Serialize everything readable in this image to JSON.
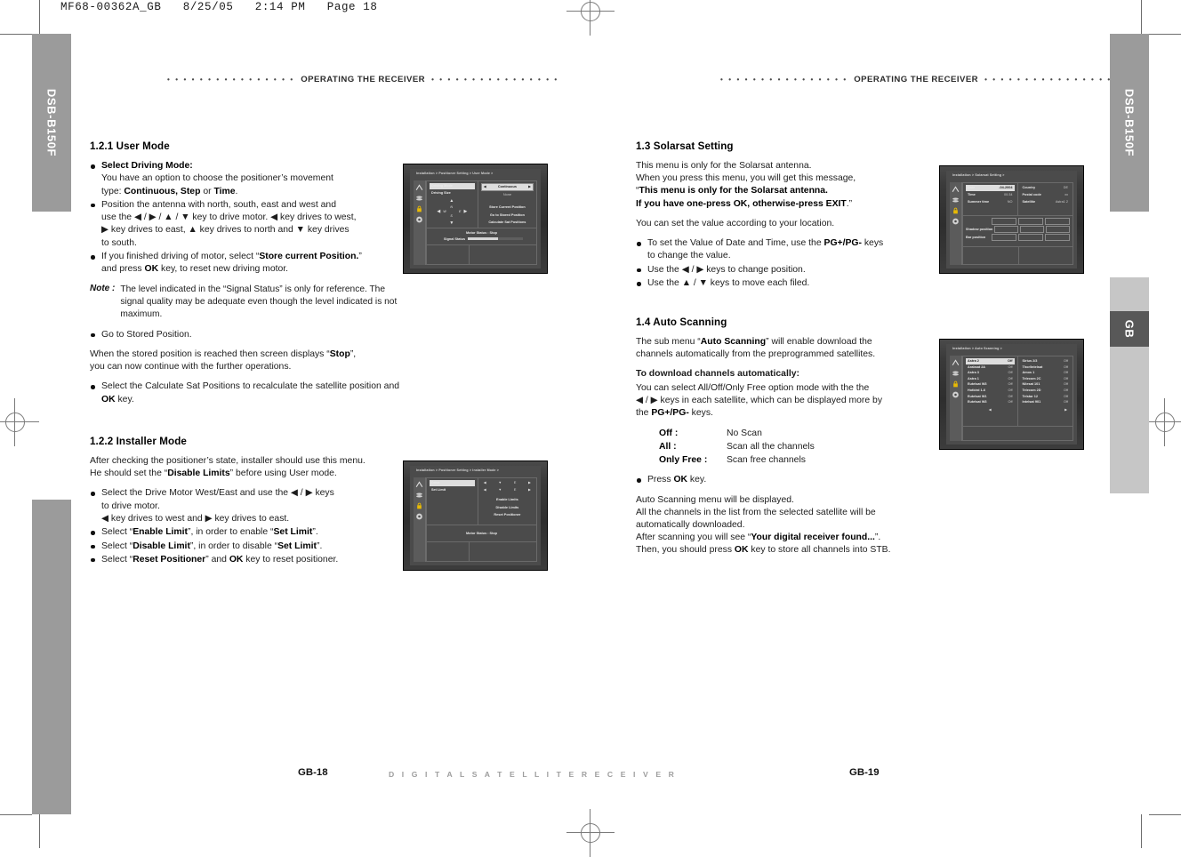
{
  "proof_header": "MF68-00362A_GB   8/25/05   2:14 PM   Page 18",
  "side_tabs": {
    "left_model": "DSB-B150F",
    "right_model": "DSB-B150F",
    "lang_tab": "GB"
  },
  "running_head": {
    "left": "OPERATING THE RECEIVER",
    "right": "OPERATING THE RECEIVER",
    "dots": "• • • • • • • • • • • • • • • •"
  },
  "left_page": {
    "page_number": "GB-18",
    "section_121": {
      "heading": "1.2.1 User Mode",
      "bullets": [
        {
          "html": "<b>Select Driving Mode:</b><br>You have an option to choose the positioner’s movement<br>type: <b>Continuous, Step</b> or <b>Time</b>."
        },
        {
          "html": "Position the antenna with north, south, east and west and<br>use the ◀ / ▶ / ▲ / ▼ key to drive motor. ◀ key drives to west,<br>▶ key drives to east, ▲ key drives to north and ▼ key drives<br>to south."
        },
        {
          "html": "If you finished driving of motor, select “<b>Store current Position.</b>”<br>and press <b>OK</b> key, to reset new driving motor."
        }
      ],
      "note_label": "Note :",
      "note_text": "The level indicated in the “Signal Status” is only for reference. The signal quality may be adequate even though the level indicated is not maximum.",
      "bullet_stored": "Go to Stored Position.",
      "para_stop": "When the stored position is reached then screen displays “<b>Stop</b>”,<br>you can now continue with the further operations.",
      "bullet_calc": "Select the Calculate Sat Positions to recalculate the satellite position and <b>OK</b> key."
    },
    "section_122": {
      "heading": "1.2.2 Installer Mode",
      "intro": "After checking the positioner’s state, installer should use this menu.<br>He should set the “<b>Disable Limits</b>” before using User mode.",
      "bullets": [
        {
          "html": "Select the Drive Motor West/East and use the ◀ / ▶ keys<br>to drive motor.<br>◀ key drives to west and ▶ key drives to east."
        },
        {
          "html": "Select “<b>Enable Limit</b>”, in order to enable “<b>Set Limit</b>”."
        },
        {
          "html": "Select “<b>Disable Limit</b>”, in order to disable “<b>Set Limit</b>”."
        },
        {
          "html": "Select “<b>Reset Positioner</b>” and <b>OK</b> key to reset positioner."
        }
      ]
    },
    "screenshot_user_mode": {
      "breadcrumb": "Installation > Positioner Setting > User Mode >",
      "rows": [
        {
          "label": "Driving Mode",
          "value": "Continuous",
          "selected": true
        },
        {
          "label": "Driving Size",
          "value": "None",
          "selected": false
        }
      ],
      "actions": [
        "Store Current Position",
        "Go to Stored Position",
        "Calculate Sat Positions"
      ],
      "motor_status": "Motor Status :  Stop",
      "signal_status": "Signal Status",
      "dpad": {
        "north": "N",
        "south": "S",
        "west": "W",
        "east": "E"
      }
    },
    "screenshot_installer_mode": {
      "breadcrumb": "Installation > Positioner Setting > Installer Mode >",
      "rows": [
        {
          "label": "Drive",
          "selected": true
        },
        {
          "label": "Set Limit",
          "selected": false
        }
      ],
      "actions": [
        "Enable Limits",
        "Disable Limits",
        "Reset Positioner"
      ],
      "motor_status": "Motor Status :  Stop"
    }
  },
  "right_page": {
    "page_number": "GB-19",
    "section_13": {
      "heading": "1.3 Solarsat Setting",
      "para1": "This menu is only for the Solarsat antenna.<br>When you press this menu, you will get this message,<br>“<b>This menu is only for the Solarsat antenna.</b><br><b>If you have one-press OK, otherwise-press EXIT</b>.”",
      "para2": "You can set the value according to your location.",
      "bullets": [
        {
          "html": "To set the Value of Date and Time, use the <b>PG+/PG-</b> keys<br>to change the value."
        },
        {
          "html": "Use the ◀ / ▶ keys to change position."
        },
        {
          "html": "Use the ▲ / ▼ keys to move each filed."
        }
      ]
    },
    "section_14": {
      "heading": "1.4 Auto Scanning",
      "para1": "The sub menu “<b>Auto Scanning</b>” will enable download the<br>channels automatically from the preprogrammed satellites.",
      "subhead": "To download channels automatically:",
      "para2": "You can select All/Off/Only Free option mode with the the<br>◀ / ▶ keys in each satellite, which can be displayed more by<br>the <b>PG+/PG-</b> keys.",
      "definitions": [
        {
          "key": "Off :",
          "value": "No Scan"
        },
        {
          "key": "All  :",
          "value": "Scan all the channels"
        },
        {
          "key": "Only Free :",
          "value": "Scan free channels"
        }
      ],
      "bullet_press_ok": "Press <b>OK</b> key.",
      "para3": "Auto Scanning menu will be displayed.<br>All the channels in the list from the selected satellite will be<br>automatically downloaded.<br>After scanning you will see “<b>Your digital receiver found...</b>”.<br>Then, you should press <b>OK</b> key to store all channels into STB."
    },
    "screenshot_solarsat": {
      "breadcrumb": "Installation > Solarsat Setting >",
      "left_fields": [
        {
          "label": "Date",
          "value": "-04-2004",
          "selected": true
        },
        {
          "label": "Time",
          "value": "00:34",
          "selected": false
        },
        {
          "label": "Summer time",
          "value": "NO",
          "selected": false
        }
      ],
      "right_fields": [
        {
          "label": "Country",
          "value": "DE"
        },
        {
          "label": "Postal code",
          "value": "xx"
        },
        {
          "label": "Satellite",
          "value": "Astra1 2"
        }
      ],
      "grid_labels": [
        "Shadow position",
        "Bar position"
      ]
    },
    "screenshot_autoscan": {
      "breadcrumb": "Installation > Auto Scanning >",
      "col_left": [
        {
          "name": "Astra 2",
          "mode": "Off",
          "selected": true
        },
        {
          "name": "Arabsat 2A",
          "mode": "Off",
          "selected": false
        },
        {
          "name": "Astra 3",
          "mode": "Off",
          "selected": false
        },
        {
          "name": "Astra 1",
          "mode": "Off",
          "selected": false
        },
        {
          "name": "Eutelsat W3",
          "mode": "Off",
          "selected": false
        },
        {
          "name": "Hotbird 1-6",
          "mode": "Off",
          "selected": false
        },
        {
          "name": "Eutelsat W1",
          "mode": "Off",
          "selected": false
        },
        {
          "name": "Eutelsat W3",
          "mode": "Off",
          "selected": false
        }
      ],
      "col_right": [
        {
          "name": "Sirius 2/3",
          "mode": "Off"
        },
        {
          "name": "Thor/Intelsat",
          "mode": "Off"
        },
        {
          "name": "Amos 1",
          "mode": "Off"
        },
        {
          "name": "Telecom 2C",
          "mode": "Off"
        },
        {
          "name": "Nilesat 101",
          "mode": "Off"
        },
        {
          "name": "Telecom 2D",
          "mode": "Off"
        },
        {
          "name": "Telstar 12",
          "mode": "Off"
        },
        {
          "name": "Intelsat 901",
          "mode": "Off"
        }
      ],
      "pager_left": "◀",
      "pager_right": "▶"
    }
  },
  "footer": {
    "brandline": "D I G I T A L     S A T E L L I T E     R E C E I V E R"
  }
}
